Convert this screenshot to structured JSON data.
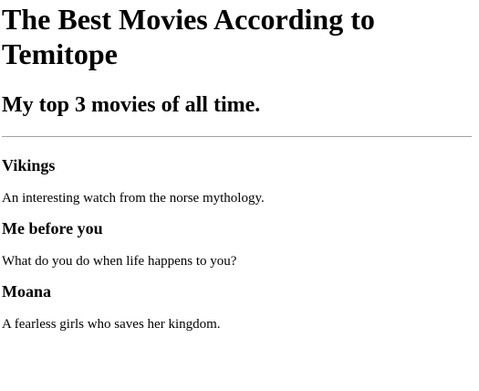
{
  "page": {
    "title": "The Best Movies According to Temitope",
    "subtitle": "My top 3 movies of all time."
  },
  "movies": [
    {
      "title": "Vikings",
      "description": "An interesting watch from the norse mythology."
    },
    {
      "title": "Me before you",
      "description": "What do you do when life happens to you?"
    },
    {
      "title": "Moana",
      "description": "A fearless girls who saves her kingdom."
    }
  ]
}
